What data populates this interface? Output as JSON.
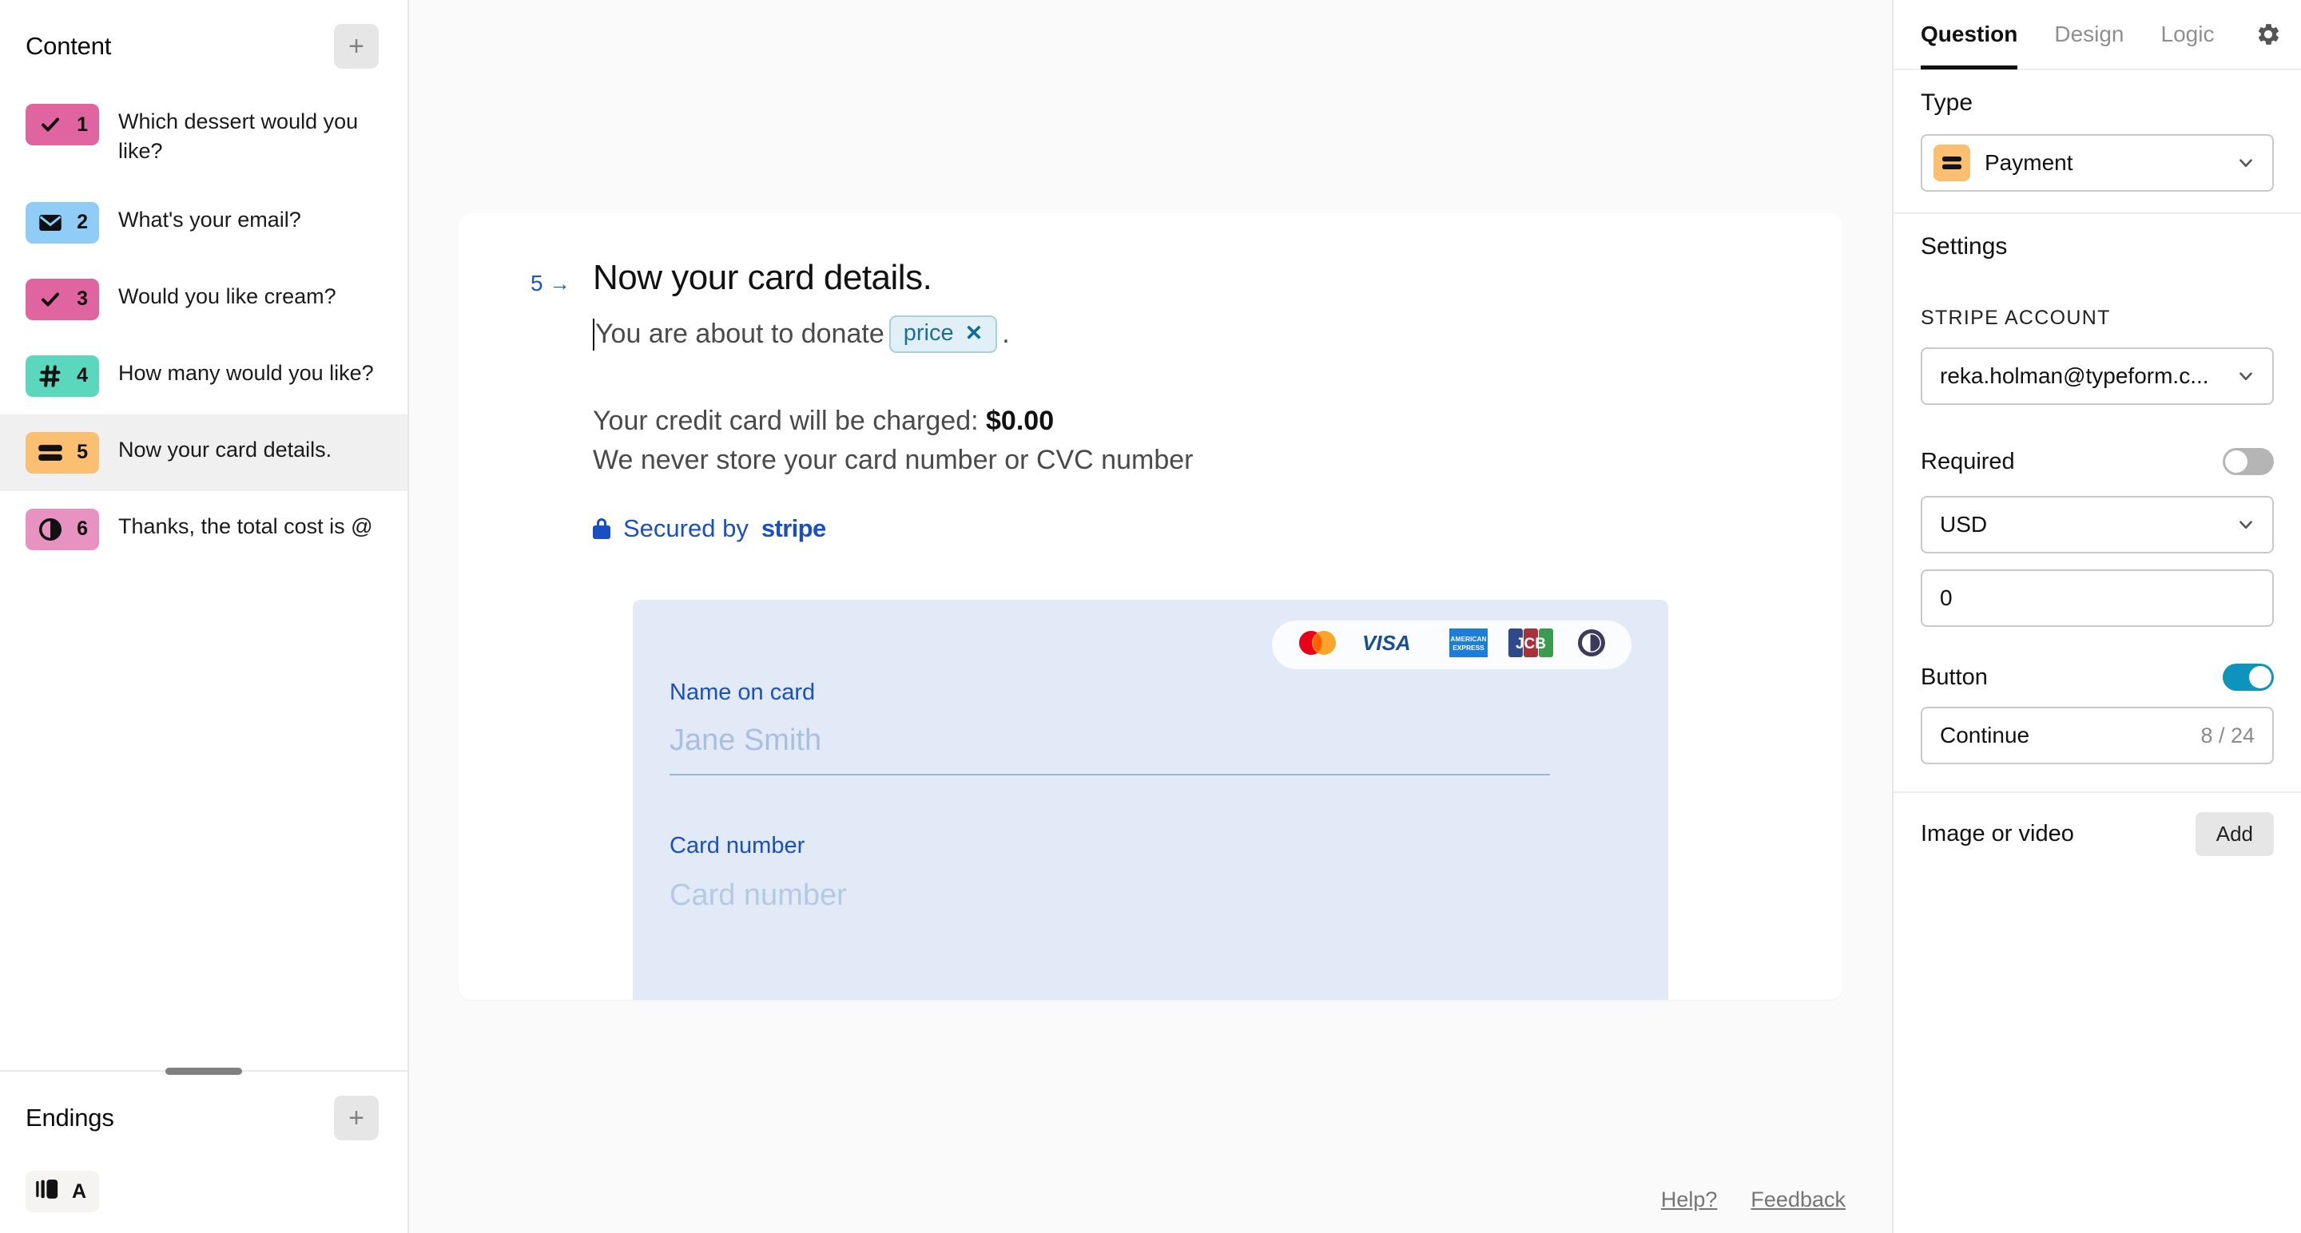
{
  "sidebar": {
    "content_title": "Content",
    "add_content_label": "+",
    "questions": [
      {
        "num": "1",
        "label": "Which dessert would you like?",
        "icon": "checkmark-icon",
        "color": "#e0649f"
      },
      {
        "num": "2",
        "label": "What's your email?",
        "icon": "envelope-icon",
        "color": "#8fcdf7"
      },
      {
        "num": "3",
        "label": "Would you like cream?",
        "icon": "checkmark-icon",
        "color": "#e0649f"
      },
      {
        "num": "4",
        "label": "How many would you like?",
        "icon": "hash-icon",
        "color": "#5bd7bd"
      },
      {
        "num": "5",
        "label": "Now your card details.",
        "icon": "credit-card-icon",
        "color": "#fbbf72",
        "selected": true
      },
      {
        "num": "6",
        "label": "Thanks, the total cost is @",
        "icon": "half-circle-icon",
        "color": "#e892c2"
      }
    ],
    "endings_title": "Endings",
    "add_ending_label": "+",
    "endings": [
      {
        "label": "A",
        "icon": "ending-screen-icon"
      }
    ]
  },
  "canvas": {
    "question_number": "5",
    "question_arrow": "→",
    "title": "Now your card details.",
    "subtitle_prefix": "You are about to donate",
    "pill_label": "price",
    "pill_remove": "✕",
    "subtitle_suffix": ".",
    "charge_label": "Your credit card will be charged:",
    "charge_amount": "$0.00",
    "store_notice": "We never store your card number or CVC number",
    "secured_prefix": "Secured by",
    "secured_brand": "stripe",
    "card_logos": [
      "mastercard-logo",
      "visa-logo",
      "amex-logo",
      "jcb-logo",
      "diners-club-logo"
    ],
    "name_label": "Name on card",
    "name_placeholder": "Jane Smith",
    "card_number_label": "Card number",
    "card_number_placeholder": "Card number",
    "footer_links": [
      "Help?",
      "Feedback"
    ]
  },
  "right_panel": {
    "tabs": [
      {
        "label": "Question",
        "active": true
      },
      {
        "label": "Design",
        "active": false
      },
      {
        "label": "Logic",
        "active": false
      }
    ],
    "settings_icon": "gear-icon",
    "type_heading": "Type",
    "type_value": "Payment",
    "type_icon": "credit-card-icon",
    "settings_heading": "Settings",
    "stripe_account_heading": "STRIPE ACCOUNT",
    "stripe_account_value": "reka.holman@typeform.c...",
    "required_label": "Required",
    "required_on": false,
    "currency_value": "USD",
    "amount_value": "0",
    "button_label": "Button",
    "button_on": true,
    "button_text": "Continue",
    "button_counter": "8 / 24",
    "image_or_video_label": "Image or video",
    "add_label": "Add"
  },
  "colors": {
    "accent_blue": "#1a4fc4",
    "toggle_on": "#0c94bd",
    "selected_row": "#f0f0f0",
    "canvas_bg": "#fafafa"
  }
}
